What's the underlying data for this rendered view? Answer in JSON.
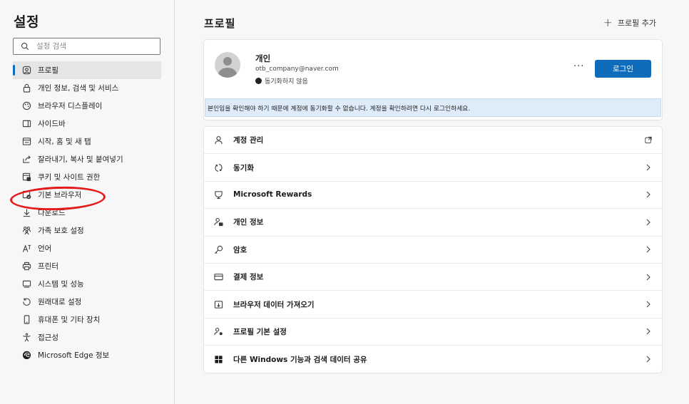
{
  "sidebar": {
    "title": "설정",
    "search_placeholder": "설정 검색",
    "items": [
      {
        "label": "프로필",
        "icon": "profile-icon",
        "active": true
      },
      {
        "label": "개인 정보, 검색 및 서비스",
        "icon": "lock-icon"
      },
      {
        "label": "브라우저 디스플레이",
        "icon": "palette-icon"
      },
      {
        "label": "사이드바",
        "icon": "sidebar-icon"
      },
      {
        "label": "시작, 홈 및 새 탭",
        "icon": "home-tab-icon"
      },
      {
        "label": "잘라내기, 복사 및 붙여넣기",
        "icon": "share-icon"
      },
      {
        "label": "쿠키 및 사이트 권한",
        "icon": "cookie-icon"
      },
      {
        "label": "기본 브라우저",
        "icon": "default-browser-icon"
      },
      {
        "label": "다운로드",
        "icon": "download-icon"
      },
      {
        "label": "가족 보호 설정",
        "icon": "family-icon"
      },
      {
        "label": "언어",
        "icon": "language-icon"
      },
      {
        "label": "프린터",
        "icon": "printer-icon"
      },
      {
        "label": "시스템 및 성능",
        "icon": "system-icon"
      },
      {
        "label": "원래대로 설정",
        "icon": "reset-icon"
      },
      {
        "label": "휴대폰 및 기타 장치",
        "icon": "phone-icon"
      },
      {
        "label": "접근성",
        "icon": "accessibility-icon"
      },
      {
        "label": "Microsoft Edge 정보",
        "icon": "edge-icon"
      }
    ]
  },
  "main": {
    "title": "프로필",
    "add_profile": "프로필 추가",
    "profile": {
      "name": "개인",
      "email": "otb_company@naver.com",
      "sync_status": "동기화하지 않음",
      "more": "···",
      "login_label": "로그인",
      "banner": "본인임을 확인해야 하기 때문에 계정에 동기화할 수 없습니다. 계정을 확인하려면 다시 로그인하세요."
    },
    "rows": [
      {
        "label": "계정 관리",
        "icon": "account-icon",
        "trailing": "external-link-icon"
      },
      {
        "label": "동기화",
        "icon": "sync-icon",
        "trailing": "chevron-right-icon"
      },
      {
        "label": "Microsoft Rewards",
        "icon": "rewards-icon",
        "trailing": "chevron-right-icon"
      },
      {
        "label": "개인 정보",
        "icon": "personal-info-icon",
        "trailing": "chevron-right-icon"
      },
      {
        "label": "암호",
        "icon": "key-icon",
        "trailing": "chevron-right-icon"
      },
      {
        "label": "결제 정보",
        "icon": "card-icon",
        "trailing": "chevron-right-icon"
      },
      {
        "label": "브라우저 데이터 가져오기",
        "icon": "import-icon",
        "trailing": "chevron-right-icon"
      },
      {
        "label": "프로필 기본 설정",
        "icon": "profile-settings-icon",
        "trailing": "chevron-right-icon"
      },
      {
        "label": "다른 Windows 기능과 검색 데이터 공유",
        "icon": "windows-icon",
        "trailing": "chevron-right-icon"
      }
    ]
  },
  "colors": {
    "accent": "#0f6cbd",
    "annotation": "#e41b1b",
    "banner_bg": "#deecf9"
  }
}
